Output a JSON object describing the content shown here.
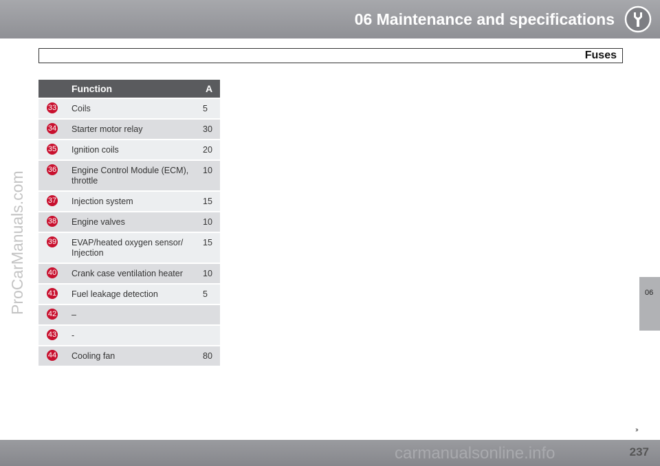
{
  "header": {
    "title": "06 Maintenance and specifications",
    "icon": "wrench-icon"
  },
  "section": {
    "title": "Fuses"
  },
  "table": {
    "columns": [
      "",
      "Function",
      "A"
    ],
    "rows": [
      {
        "num": "33",
        "function": "Coils",
        "amp": "5"
      },
      {
        "num": "34",
        "function": "Starter motor relay",
        "amp": "30"
      },
      {
        "num": "35",
        "function": "Ignition coils",
        "amp": "20"
      },
      {
        "num": "36",
        "function": "Engine Control Module (ECM), throttle",
        "amp": "10"
      },
      {
        "num": "37",
        "function": "Injection system",
        "amp": "15"
      },
      {
        "num": "38",
        "function": "Engine valves",
        "amp": "10"
      },
      {
        "num": "39",
        "function": "EVAP/heated oxygen sensor/ Injection",
        "amp": "15"
      },
      {
        "num": "40",
        "function": "Crank case ventilation heater",
        "amp": "10"
      },
      {
        "num": "41",
        "function": "Fuel leakage detection",
        "amp": "5"
      },
      {
        "num": "42",
        "function": "–",
        "amp": ""
      },
      {
        "num": "43",
        "function": "-",
        "amp": ""
      },
      {
        "num": "44",
        "function": "Cooling fan",
        "amp": "80"
      }
    ]
  },
  "side_tab": {
    "label": "06"
  },
  "watermark": "ProCarManuals.com",
  "footer": {
    "continue_symbol": "››",
    "page_number": "237",
    "watermark": "carmanualsonline.info"
  },
  "colors": {
    "badge": "#c8102e",
    "header_gray": "#9a9b9f",
    "table_head": "#5a5b5e"
  }
}
